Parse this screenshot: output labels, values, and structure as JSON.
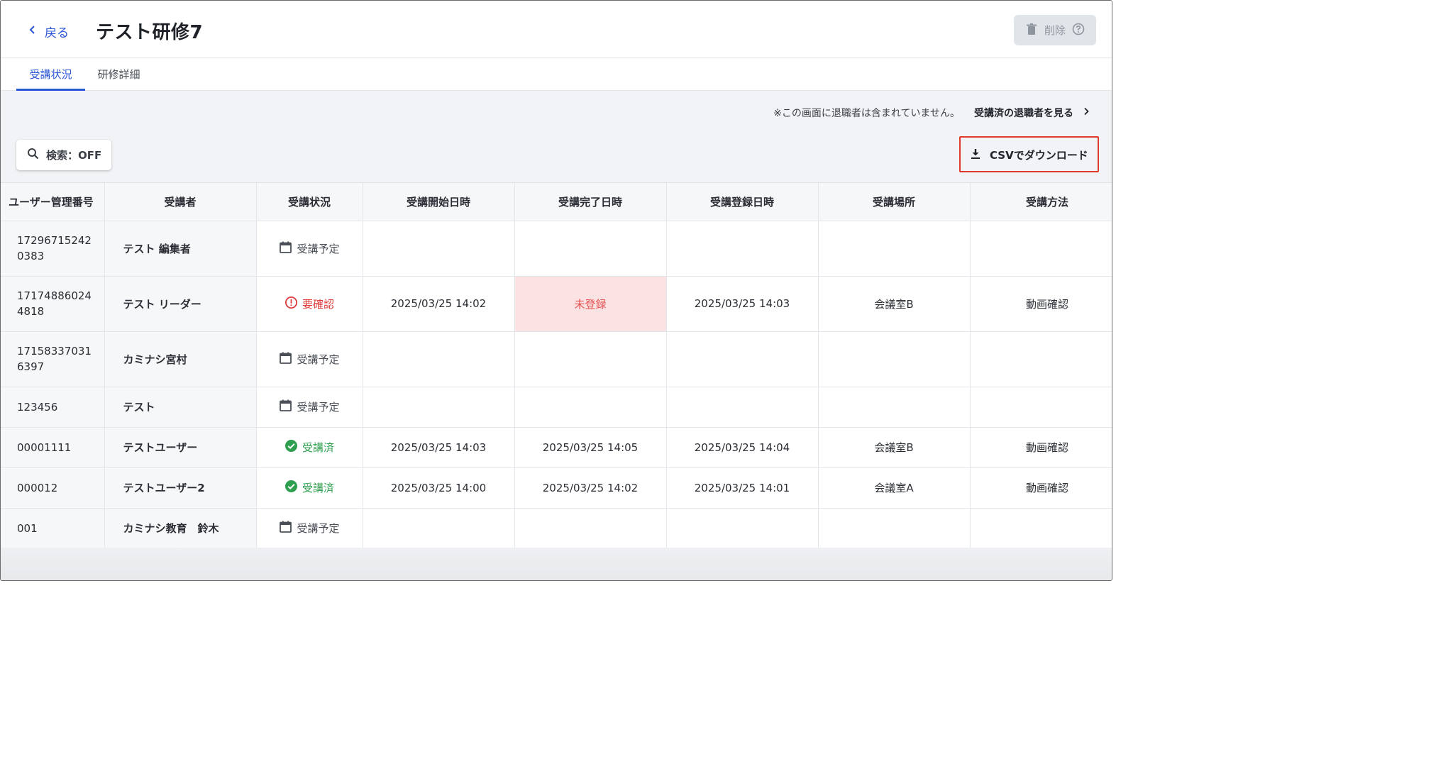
{
  "header": {
    "back_label": "戻る",
    "title": "テスト研修7",
    "delete_label": "削除"
  },
  "tabs": [
    {
      "label": "受講状況",
      "active": true
    },
    {
      "label": "研修詳細",
      "active": false
    }
  ],
  "notice": {
    "text": "※この画面に退職者は含まれていません。",
    "link_label": "受講済の退職者を見る"
  },
  "toolbar": {
    "search_label": "検索：OFF",
    "csv_label": "CSVでダウンロード"
  },
  "table": {
    "headers": [
      "ユーザー管理番号",
      "受講者",
      "受講状況",
      "受講開始日時",
      "受講完了日時",
      "受講登録日時",
      "受講場所",
      "受講方法"
    ],
    "rows": [
      {
        "id": [
          "17296715242",
          "0383"
        ],
        "name": "テスト 編集者",
        "status": "受講予定",
        "status_type": "planned",
        "start": "",
        "complete": "",
        "registered": "",
        "place": "",
        "method": ""
      },
      {
        "id": [
          "17174886024",
          "4818"
        ],
        "name": "テスト リーダー",
        "status": "要確認",
        "status_type": "check",
        "start": "2025/03/25 14:02",
        "complete": "未登録",
        "registered": "2025/03/25 14:03",
        "place": "会議室B",
        "method": "動画確認"
      },
      {
        "id": [
          "17158337031",
          "6397"
        ],
        "name": "カミナシ宮村",
        "status": "受講予定",
        "status_type": "planned",
        "start": "",
        "complete": "",
        "registered": "",
        "place": "",
        "method": ""
      },
      {
        "id": [
          "123456"
        ],
        "name": "テスト",
        "status": "受講予定",
        "status_type": "planned",
        "start": "",
        "complete": "",
        "registered": "",
        "place": "",
        "method": ""
      },
      {
        "id": [
          "00001111"
        ],
        "name": "テストユーザー",
        "status": "受講済",
        "status_type": "done",
        "start": "2025/03/25 14:03",
        "complete": "2025/03/25 14:05",
        "registered": "2025/03/25 14:04",
        "place": "会議室B",
        "method": "動画確認"
      },
      {
        "id": [
          "000012"
        ],
        "name": "テストユーザー2",
        "status": "受講済",
        "status_type": "done",
        "start": "2025/03/25 14:00",
        "complete": "2025/03/25 14:02",
        "registered": "2025/03/25 14:01",
        "place": "会議室A",
        "method": "動画確認"
      },
      {
        "id": [
          "001"
        ],
        "name": "カミナシ教育　鈴木",
        "status": "受講予定",
        "status_type": "planned",
        "start": "",
        "complete": "",
        "registered": "",
        "place": "",
        "method": ""
      }
    ]
  },
  "colors": {
    "accent": "#2b57d6",
    "danger": "#e03a3a",
    "success": "#2e9f4e",
    "highlight_border": "#e03a2d",
    "unregistered_bg": "#fbe3e3"
  }
}
